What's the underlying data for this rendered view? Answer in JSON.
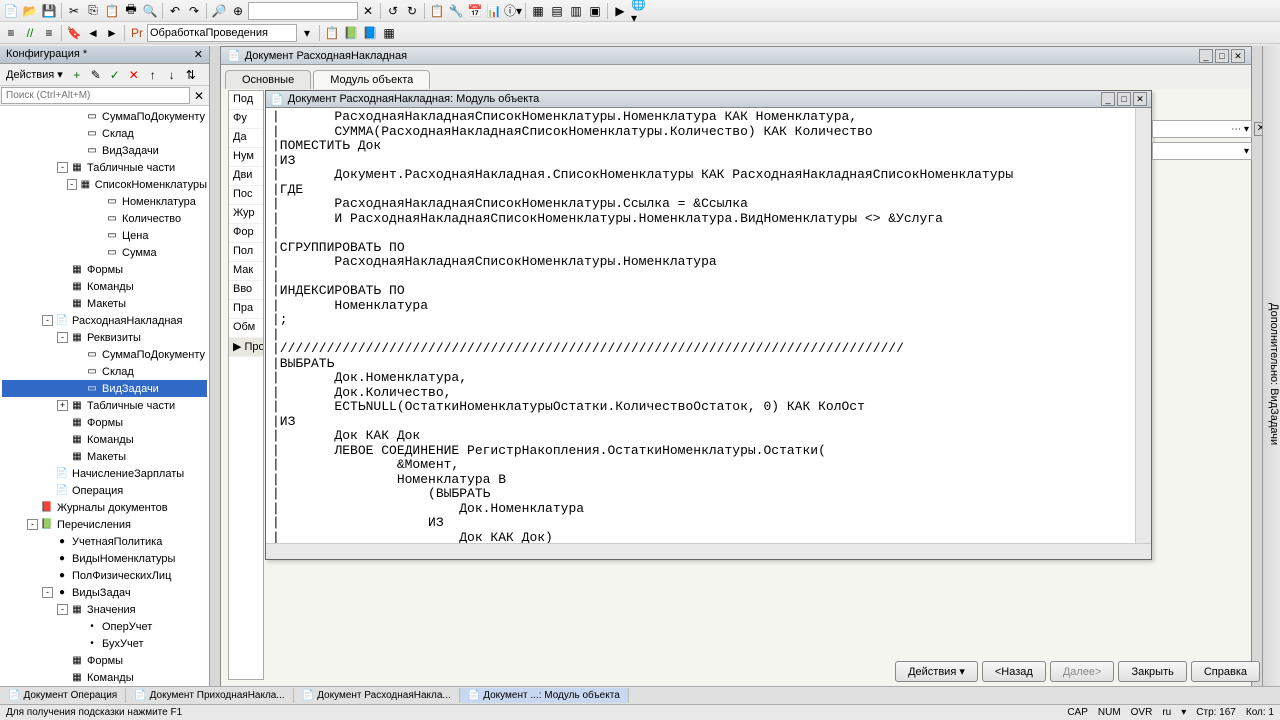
{
  "toolbar2_combo": "ОбработкаПроведения",
  "config": {
    "title": "Конфигурация *",
    "actions_label": "Действия",
    "search_placeholder": "Поиск (Ctrl+Alt+M)"
  },
  "tree_items": [
    {
      "indent": 70,
      "icon": "▭",
      "label": "СуммаПоДокументу"
    },
    {
      "indent": 70,
      "icon": "▭",
      "label": "Склад"
    },
    {
      "indent": 70,
      "icon": "▭",
      "label": "ВидЗадачи"
    },
    {
      "indent": 55,
      "expand": "-",
      "icon": "▦",
      "label": "Табличные части"
    },
    {
      "indent": 70,
      "expand": "-",
      "icon": "▦",
      "label": "СписокНоменклатуры"
    },
    {
      "indent": 90,
      "icon": "▭",
      "label": "Номенклатура"
    },
    {
      "indent": 90,
      "icon": "▭",
      "label": "Количество"
    },
    {
      "indent": 90,
      "icon": "▭",
      "label": "Цена"
    },
    {
      "indent": 90,
      "icon": "▭",
      "label": "Сумма"
    },
    {
      "indent": 55,
      "icon": "▦",
      "label": "Формы"
    },
    {
      "indent": 55,
      "icon": "▦",
      "label": "Команды"
    },
    {
      "indent": 55,
      "icon": "▦",
      "label": "Макеты"
    },
    {
      "indent": 40,
      "expand": "-",
      "icon": "📄",
      "label": "РасходнаяНакладная"
    },
    {
      "indent": 55,
      "expand": "-",
      "icon": "▦",
      "label": "Реквизиты"
    },
    {
      "indent": 70,
      "icon": "▭",
      "label": "СуммаПоДокументу"
    },
    {
      "indent": 70,
      "icon": "▭",
      "label": "Склад"
    },
    {
      "indent": 70,
      "icon": "▭",
      "label": "ВидЗадачи",
      "selected": true
    },
    {
      "indent": 55,
      "expand": "+",
      "icon": "▦",
      "label": "Табличные части"
    },
    {
      "indent": 55,
      "icon": "▦",
      "label": "Формы"
    },
    {
      "indent": 55,
      "icon": "▦",
      "label": "Команды"
    },
    {
      "indent": 55,
      "icon": "▦",
      "label": "Макеты"
    },
    {
      "indent": 40,
      "icon": "📄",
      "label": "НачислениеЗарплаты"
    },
    {
      "indent": 40,
      "icon": "📄",
      "label": "Операция"
    },
    {
      "indent": 25,
      "icon": "📕",
      "label": "Журналы документов"
    },
    {
      "indent": 25,
      "expand": "-",
      "icon": "📗",
      "label": "Перечисления"
    },
    {
      "indent": 40,
      "icon": "●",
      "label": "УчетнаяПолитика"
    },
    {
      "indent": 40,
      "icon": "●",
      "label": "ВидыНоменклатуры"
    },
    {
      "indent": 40,
      "icon": "●",
      "label": "ПолФизическихЛиц"
    },
    {
      "indent": 40,
      "expand": "-",
      "icon": "●",
      "label": "ВидыЗадач"
    },
    {
      "indent": 55,
      "expand": "-",
      "icon": "▦",
      "label": "Значения"
    },
    {
      "indent": 70,
      "icon": "•",
      "label": "ОперУчет"
    },
    {
      "indent": 70,
      "icon": "•",
      "label": "БухУчет"
    },
    {
      "indent": 55,
      "icon": "▦",
      "label": "Формы"
    },
    {
      "indent": 55,
      "icon": "▦",
      "label": "Команды"
    },
    {
      "indent": 55,
      "icon": "▦",
      "label": "Макеты"
    }
  ],
  "doc_window_title": "Документ РасходнаяНакладная",
  "doc_tabs": {
    "main": "Основные",
    "module": "Модуль объекта"
  },
  "inner_items": [
    "Под",
    "Фу",
    "Да",
    "Нум",
    "Дви",
    "Пос",
    "Жур",
    "Фор",
    "Пол",
    "Мак",
    "Вво",
    "Пра",
    "Обм",
    "Про"
  ],
  "code_window_title": "Документ РасходнаяНакладная: Модуль объекта",
  "code": "|       РасходнаяНакладнаяСписокНоменклатуры.Номенклатура КАК Номенклатура,\n|       СУММА(РасходнаяНакладнаяСписокНоменклатуры.Количество) КАК Количество\n|ПОМЕСТИТЬ Док\n|ИЗ\n|       Документ.РасходнаяНакладная.СписокНоменклатуры КАК РасходнаяНакладнаяСписокНоменклатуры\n|ГДЕ\n|       РасходнаяНакладнаяСписокНоменклатуры.Ссылка = &Ссылка\n|       И РасходнаяНакладнаяСписокНоменклатуры.Номенклатура.ВидНоменклатуры <> &Услуга\n|\n|СГРУППИРОВАТЬ ПО\n|       РасходнаяНакладнаяСписокНоменклатуры.Номенклатура\n|\n|ИНДЕКСИРОВАТЬ ПО\n|       Номенклатура\n|;\n|\n|////////////////////////////////////////////////////////////////////////////////\n|ВЫБРАТЬ\n|       Док.Номенклатура,\n|       Док.Количество,\n|       ЕСТЬNULL(ОстаткиНоменклатурыОстатки.КоличествоОстаток, 0) КАК КолОст\n|ИЗ\n|       Док КАК Док\n|       ЛЕВОЕ СОЕДИНЕНИЕ РегистрНакопления.ОстаткиНоменклатуры.Остатки(\n|               &Момент,\n|               Номенклатура В\n|                   (ВЫБРАТЬ\n|                       Док.Номенклатура\n|                   ИЗ\n|                       Док КАК Док)",
  "buttons": {
    "actions": "Действия",
    "back": "<Назад",
    "next": "Далее>",
    "close": "Закрыть",
    "help": "Справка"
  },
  "bottom_tabs": [
    "Документ Операция",
    "Документ ПриходнаяНакла...",
    "Документ РасходнаяНакла...",
    "Документ ...: Модуль объекта"
  ],
  "status": {
    "hint": "Для получения подсказки нажмите F1",
    "cap": "CAP",
    "num": "NUM",
    "ovr": "OVR",
    "lang": "ru",
    "line": "Стр: 167",
    "col": "Кол: 1"
  },
  "right_label": "Дополнительно: ВидЗадачи"
}
